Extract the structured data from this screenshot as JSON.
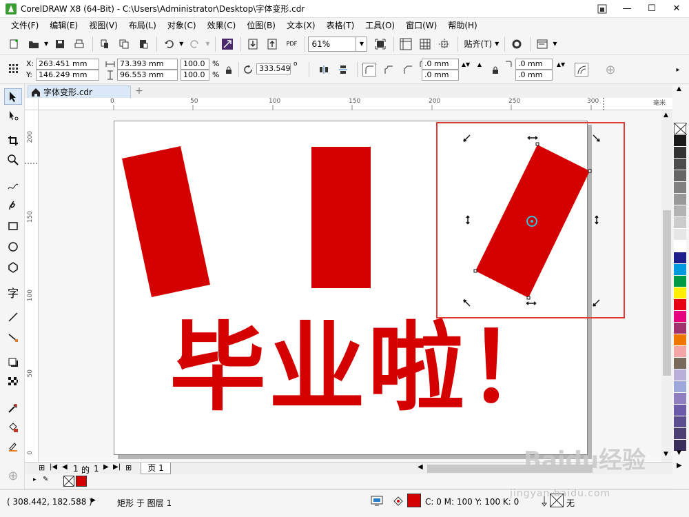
{
  "window": {
    "title": "CorelDRAW X8 (64-Bit) - C:\\Users\\Administrator\\Desktop\\字体变形.cdr"
  },
  "menu": [
    "文件(F)",
    "编辑(E)",
    "视图(V)",
    "布局(L)",
    "对象(C)",
    "效果(C)",
    "位图(B)",
    "文本(X)",
    "表格(T)",
    "工具(O)",
    "窗口(W)",
    "帮助(H)"
  ],
  "toolbar": {
    "zoom": "61%",
    "snap_label": "贴齐(T)",
    "pdf_label": "PDF"
  },
  "properties": {
    "x": "263.451 mm",
    "y": "146.249 mm",
    "width": "73.393 mm",
    "height": "96.553 mm",
    "scale_x": "100.0",
    "scale_y": "100.0",
    "pct": "%",
    "rotation": "333.549",
    "degree": "o",
    "corner1": ".0 mm",
    "corner2": ".0 mm",
    "corner3": ".0 mm",
    "corner4": ".0 mm",
    "x_label": "X:",
    "y_label": "Y:"
  },
  "tab": {
    "name": "字体变形.cdr"
  },
  "ruler": {
    "h_ticks": [
      "0",
      "50",
      "100",
      "150",
      "200",
      "250",
      "300"
    ],
    "unit": "毫米",
    "v_ticks": [
      "200",
      "150",
      "100",
      "50",
      "0"
    ]
  },
  "canvas": {
    "text": "毕业啦！",
    "fill": "#d40000"
  },
  "pagenav": {
    "current": "1",
    "of": "的",
    "total": "1",
    "page_tab": "页 1"
  },
  "status": {
    "coords": "( 308.442, 182.588 )",
    "object_info": "矩形 于 图层 1",
    "fill_info": "C: 0 M: 100 Y: 100 K: 0",
    "outline": "无"
  },
  "palette": [
    "#1a1a1a",
    "#333333",
    "#4d4d4d",
    "#666666",
    "#808080",
    "#999999",
    "#b3b3b3",
    "#cccccc",
    "#e6e6e6",
    "#ffffff",
    "#1d1d8c",
    "#0099dd",
    "#009944",
    "#ffee00",
    "#e60012",
    "#e4007f",
    "#a0306e",
    "#ee7700",
    "#f4a6a6",
    "#7a6a5a",
    "#b8b0d8",
    "#9fa8da",
    "#8f7fc0",
    "#6b5ba8",
    "#5c4f8f",
    "#4b3f73",
    "#3a2e5c"
  ],
  "watermark": {
    "main": "Baidu经验",
    "sub": "jingyan.baidu.com"
  }
}
